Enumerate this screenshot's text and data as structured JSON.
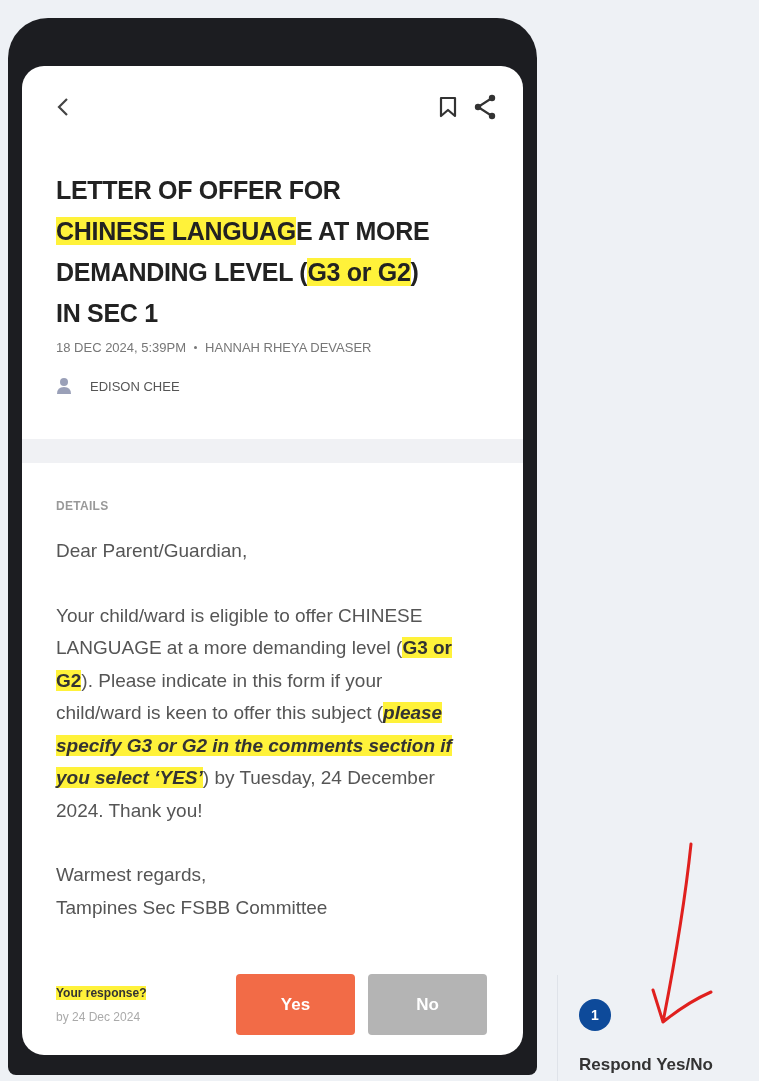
{
  "header": {
    "title_segments": [
      {
        "text": "LETTER OF OFFER FOR ",
        "highlighted": false
      },
      {
        "text": "CHINESE LANGUAG",
        "highlighted": true
      },
      {
        "text": "E AT MORE DEMANDING LEVEL (",
        "highlighted": false
      },
      {
        "text": "G3 or G2",
        "highlighted": true
      },
      {
        "text": ") IN SEC 1",
        "highlighted": false
      }
    ],
    "meta": "18 DEC 2024, 5:39PM",
    "author": "HANNAH RHEYA DEVASER",
    "recipient": "EDISON CHEE"
  },
  "details": {
    "label": "DETAILS",
    "greeting": "Dear Parent/Guardian,",
    "body_segments": [
      {
        "text": "Your child/ward is eligible to offer CHINESE LANGUAGE at a more demanding level (",
        "highlighted": false
      },
      {
        "text": "G3 or G2",
        "highlighted": true,
        "bold": true,
        "italic": false
      },
      {
        "text": "). Please indicate in this form if your child/ward is keen to offer this subject (",
        "highlighted": false
      },
      {
        "text": "please specify G3 or G2 in the comments section if you select ‘YES’",
        "highlighted": true,
        "bold": true,
        "italic": true
      },
      {
        "text": ") by Tuesday, 24 December 2024. Thank you!",
        "highlighted": false
      }
    ],
    "closing": "Warmest regards,",
    "signature": "Tampines Sec FSBB Committee"
  },
  "response": {
    "prompt": "Your response?",
    "prompt_highlighted": true,
    "deadline": "by 24 Dec 2024",
    "buttons": [
      {
        "label": "Yes",
        "kind": "primary"
      },
      {
        "label": "No",
        "kind": "secondary"
      }
    ]
  },
  "annotation": {
    "step": "1",
    "caption": "Respond Yes/No"
  }
}
